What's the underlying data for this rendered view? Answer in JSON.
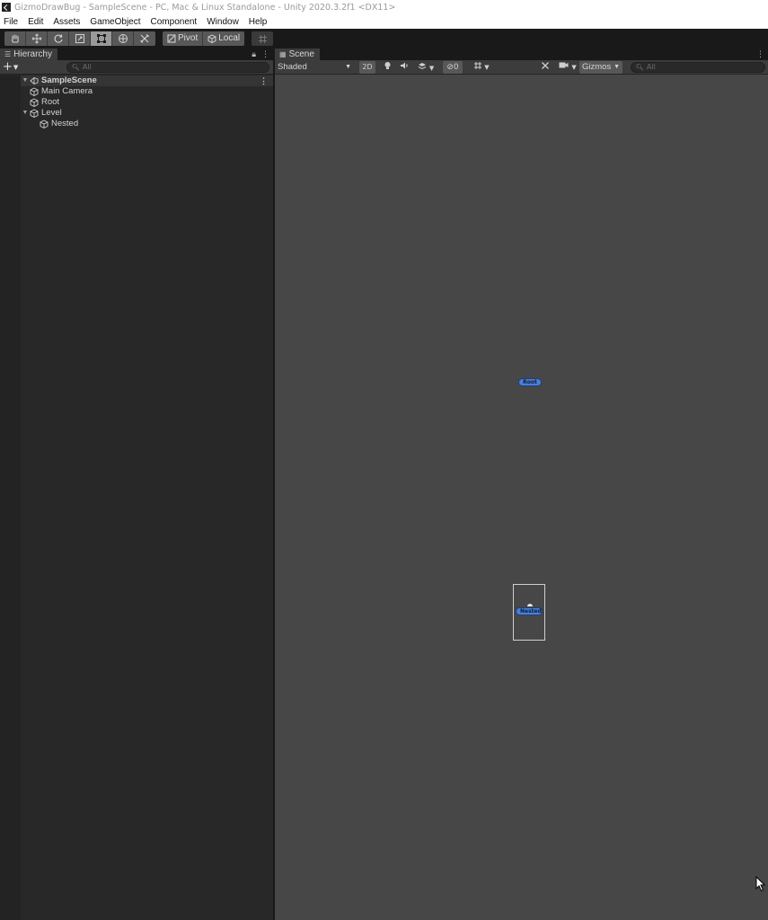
{
  "window": {
    "title": "GizmoDrawBug - SampleScene - PC, Mac & Linux Standalone - Unity 2020.3.2f1 <DX11>"
  },
  "menubar": {
    "items": [
      "File",
      "Edit",
      "Assets",
      "GameObject",
      "Component",
      "Window",
      "Help"
    ]
  },
  "toolbar": {
    "tools": [
      {
        "name": "hand-tool",
        "icon": "hand-icon",
        "active": false
      },
      {
        "name": "move-tool",
        "icon": "move-icon",
        "active": false
      },
      {
        "name": "rotate-tool",
        "icon": "rotate-icon",
        "active": false
      },
      {
        "name": "scale-tool",
        "icon": "scale-icon",
        "active": false
      },
      {
        "name": "rect-tool",
        "icon": "rect-icon",
        "active": true
      },
      {
        "name": "transform-tool",
        "icon": "transform-icon",
        "active": false
      },
      {
        "name": "custom-tool",
        "icon": "custom-tools-icon",
        "active": false
      }
    ],
    "pivot_label": "Pivot",
    "local_label": "Local"
  },
  "hierarchy": {
    "tab_label": "Hierarchy",
    "search_placeholder": "All",
    "scene_name": "SampleScene",
    "items": [
      {
        "label": "Main Camera"
      },
      {
        "label": "Root"
      },
      {
        "label": "Level"
      },
      {
        "label": "Nested"
      }
    ]
  },
  "scene": {
    "tab_label": "Scene",
    "shading_mode": "Shaded",
    "mode_2d_label": "2D",
    "hidden_count": "0",
    "gizmos_label": "Gizmos",
    "search_placeholder": "All",
    "labels": {
      "root": "Root",
      "nested": "Nested"
    }
  },
  "colors": {
    "gizmo_label_fill": "#4a7fd6",
    "viewport_background": "#474747",
    "panel_background": "#282828"
  }
}
